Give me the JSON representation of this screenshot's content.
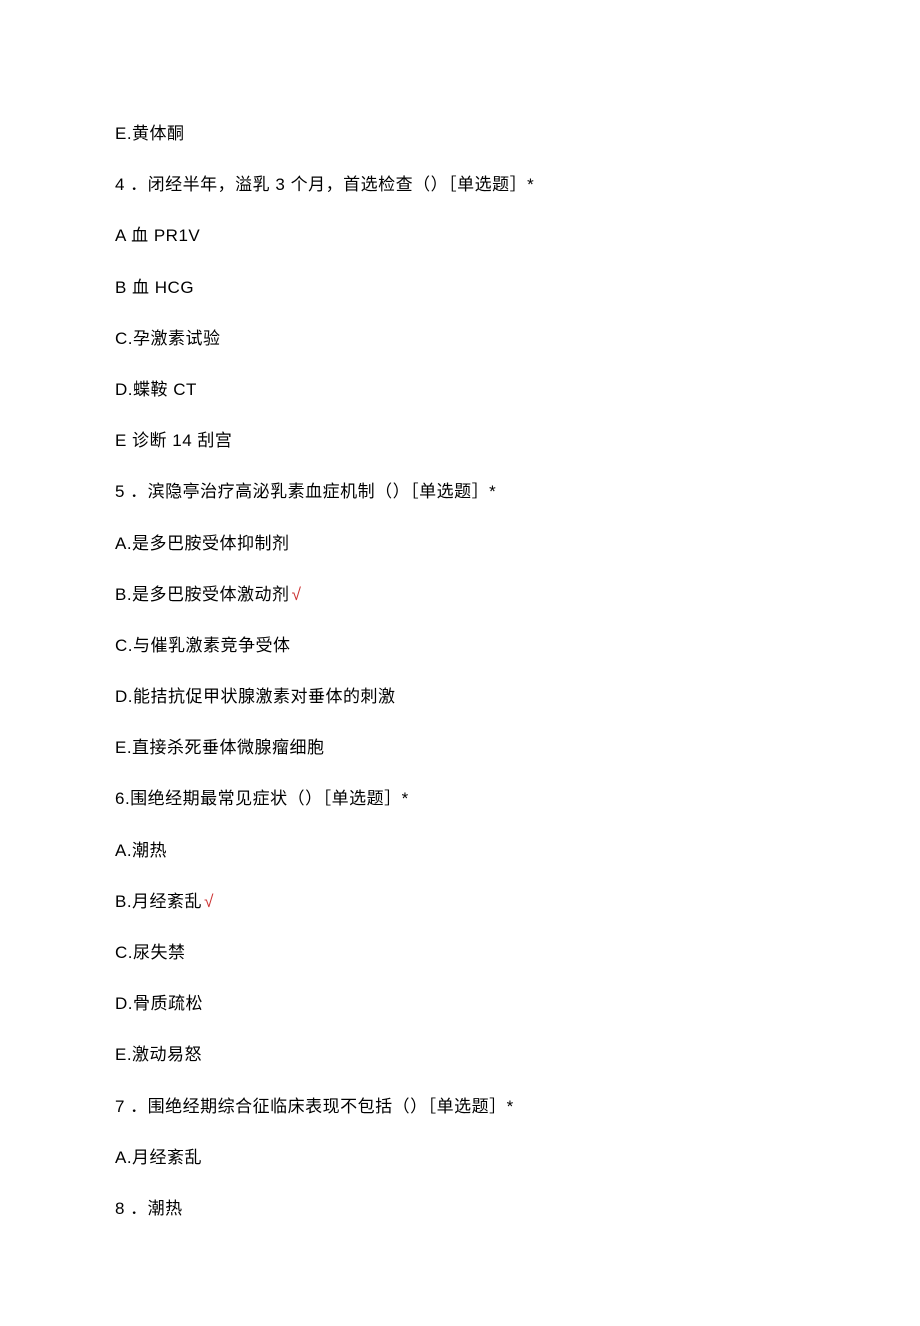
{
  "items": [
    {
      "text": "E.黄体酮",
      "correct": false
    },
    {
      "text": "4 ．闭经半年，溢乳 3 个月，首选检查（）［单选题］*",
      "correct": false
    },
    {
      "text": "A 血 PR1V",
      "correct": false
    },
    {
      "text": "B 血 HCG",
      "correct": false
    },
    {
      "text": "C.孕激素试验",
      "correct": false
    },
    {
      "text": "D.蝶鞍 CT",
      "correct": false
    },
    {
      "text": "E 诊断 14 刮宫",
      "correct": false
    },
    {
      "text": "5 ．滨隐亭治疗高泌乳素血症机制（）［单选题］*",
      "correct": false
    },
    {
      "text": "A.是多巴胺受体抑制剂",
      "correct": false
    },
    {
      "text": "B.是多巴胺受体激动剂",
      "correct": true
    },
    {
      "text": "C.与催乳激素竞争受体",
      "correct": false
    },
    {
      "text": "D.能拮抗促甲状腺激素对垂体的刺激",
      "correct": false
    },
    {
      "text": "E.直接杀死垂体微腺瘤细胞",
      "correct": false
    },
    {
      "text": "6.围绝经期最常见症状（）［单选题］*",
      "correct": false
    },
    {
      "text": "A.潮热",
      "correct": false
    },
    {
      "text": "B.月经紊乱",
      "correct": true
    },
    {
      "text": "C.尿失禁",
      "correct": false
    },
    {
      "text": "D.骨质疏松",
      "correct": false
    },
    {
      "text": "E.激动易怒",
      "correct": false
    },
    {
      "text": "7 ．围绝经期综合征临床表现不包括（）［单选题］*",
      "correct": false
    },
    {
      "text": "A.月经紊乱",
      "correct": false
    },
    {
      "text": "8 ．潮热",
      "correct": false
    }
  ],
  "check_mark": "√"
}
